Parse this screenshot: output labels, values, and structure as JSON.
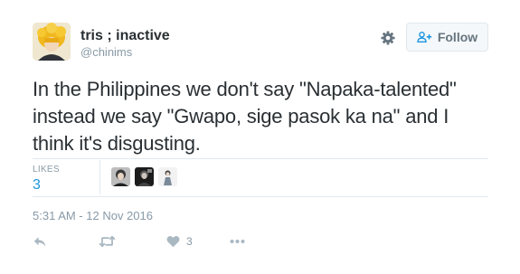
{
  "user": {
    "display_name": "tris ; inactive",
    "handle": "@chinims",
    "avatar_icon": "avatar-yellow-hair"
  },
  "header": {
    "settings_icon": "gear-icon",
    "follow_label": "Follow",
    "follow_icon": "add-user-icon"
  },
  "tweet": {
    "text": "In the Philippines we don't say \"Napaka-talented\" instead we say \"Gwapo, sige pasok ka na\" and I think it's disgusting."
  },
  "stats": {
    "likes_label": "LIKES",
    "likes_count": "3",
    "likers": [
      "liker-avatar-1",
      "liker-avatar-2",
      "liker-avatar-3"
    ]
  },
  "timestamp": "5:31 AM - 12 Nov 2016",
  "actions": {
    "reply_icon": "reply-icon",
    "retweet_icon": "retweet-icon",
    "like_icon": "heart-icon",
    "like_count": "3",
    "more_icon": "more-icon"
  },
  "colors": {
    "text": "#292f33",
    "muted": "#8899a6",
    "link": "#1b95e0",
    "border": "#e1e8ed",
    "button_bg": "#f5f8fa"
  }
}
